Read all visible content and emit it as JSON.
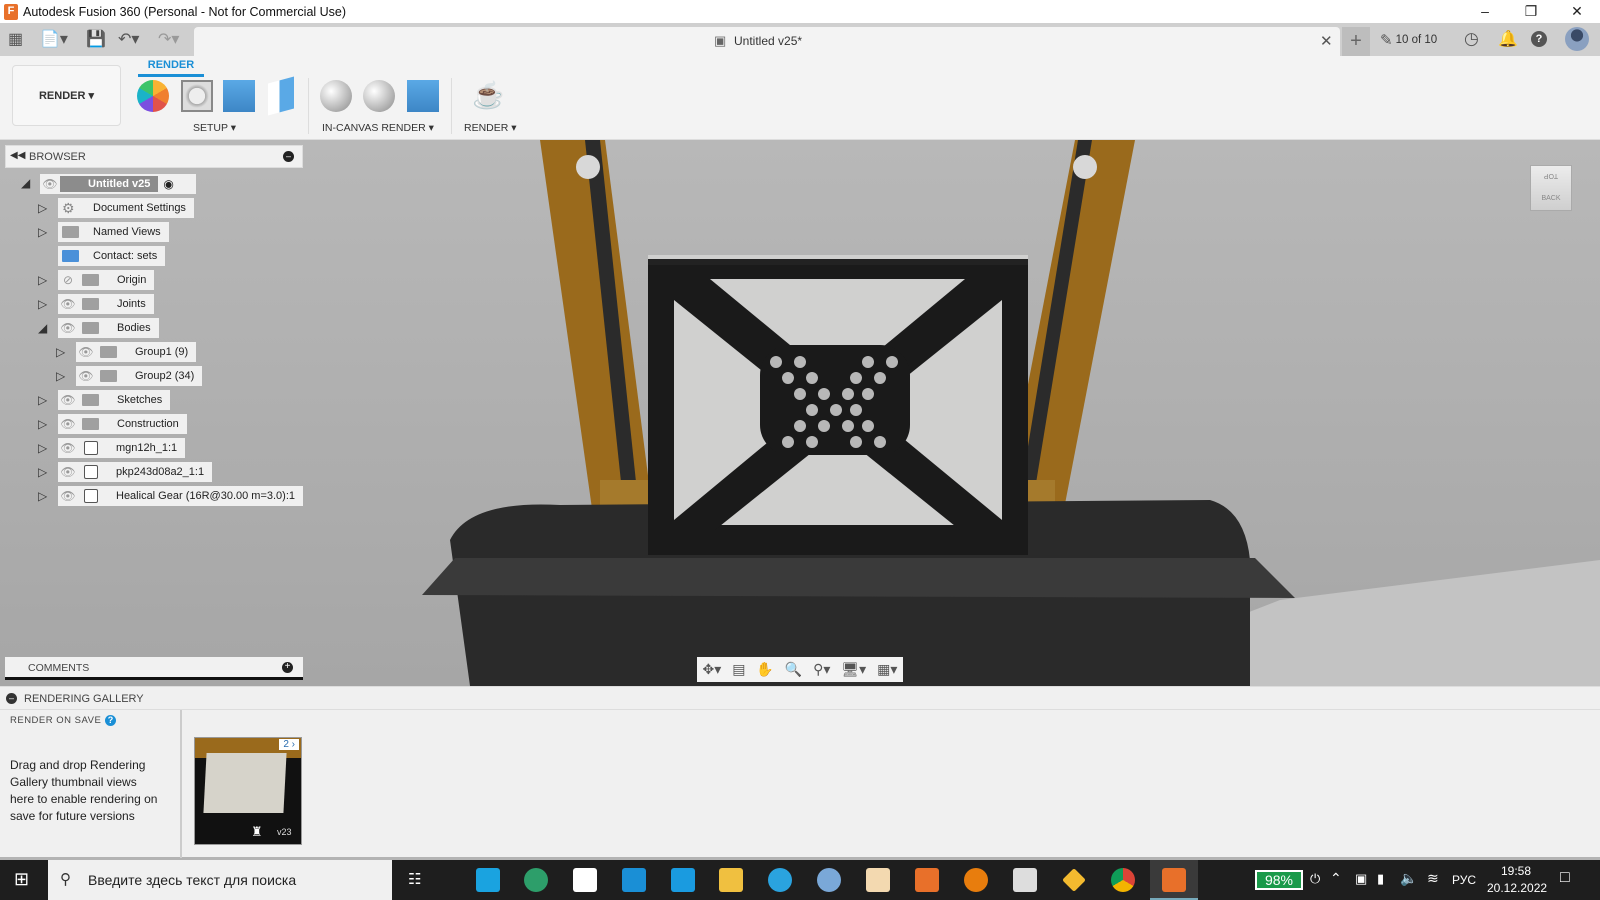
{
  "window": {
    "title": "Autodesk Fusion 360 (Personal - Not for Commercial Use)",
    "app_icon_letter": "F"
  },
  "document_tab": {
    "title": "Untitled v25*"
  },
  "header_right": {
    "versions": "10 of 10"
  },
  "ribbon": {
    "workspace": "RENDER",
    "active_tab": "RENDER",
    "groups": [
      "SETUP",
      "IN-CANVAS RENDER",
      "RENDER"
    ]
  },
  "browser": {
    "title": "BROWSER",
    "root": "Untitled v25",
    "items": [
      {
        "label": "Document Settings",
        "icon": "gear-icon",
        "expander": "collapsed",
        "indent": 1
      },
      {
        "label": "Named Views",
        "icon": "folder-icon",
        "expander": "collapsed",
        "indent": 1
      },
      {
        "label": "Contact: sets",
        "icon": "contact-sets-icon",
        "expander": "none",
        "indent": 1
      },
      {
        "label": "Origin",
        "icon": "folder-icon",
        "expander": "collapsed",
        "indent": 1,
        "hidden": true
      },
      {
        "label": "Joints",
        "icon": "folder-icon",
        "expander": "collapsed",
        "indent": 1
      },
      {
        "label": "Bodies",
        "icon": "folder-icon",
        "expander": "expanded",
        "indent": 1
      },
      {
        "label": "Group1 (9)",
        "icon": "folder-icon",
        "expander": "collapsed",
        "indent": 2
      },
      {
        "label": "Group2 (34)",
        "icon": "folder-icon",
        "expander": "collapsed",
        "indent": 2
      },
      {
        "label": "Sketches",
        "icon": "folder-icon",
        "expander": "collapsed",
        "indent": 1
      },
      {
        "label": "Construction",
        "icon": "folder-icon",
        "expander": "collapsed",
        "indent": 1
      },
      {
        "label": "mgn12h_1:1",
        "icon": "component-icon",
        "expander": "collapsed",
        "indent": 1
      },
      {
        "label": "pkp243d08a2_1:1",
        "icon": "component-icon",
        "expander": "collapsed",
        "indent": 1
      },
      {
        "label": "Healical Gear (16R@30.00 m=3.0):1",
        "icon": "component-icon",
        "expander": "collapsed",
        "indent": 1
      }
    ]
  },
  "comments": {
    "title": "COMMENTS"
  },
  "gallery": {
    "title": "RENDERING GALLERY",
    "render_on_save": "RENDER ON SAVE",
    "hint": "Drag and drop Rendering Gallery thumbnail views here to enable rendering on save for future versions",
    "thumb_count": "2",
    "thumb_version": "v23"
  },
  "viewcube": {
    "top": "TOP",
    "back": "BACK"
  },
  "taskbar": {
    "search_placeholder": "Введите здесь текст для поиска",
    "battery": "98%",
    "battery_level": 98,
    "language": "РУС",
    "time": "19:58",
    "date": "20.12.2022"
  }
}
